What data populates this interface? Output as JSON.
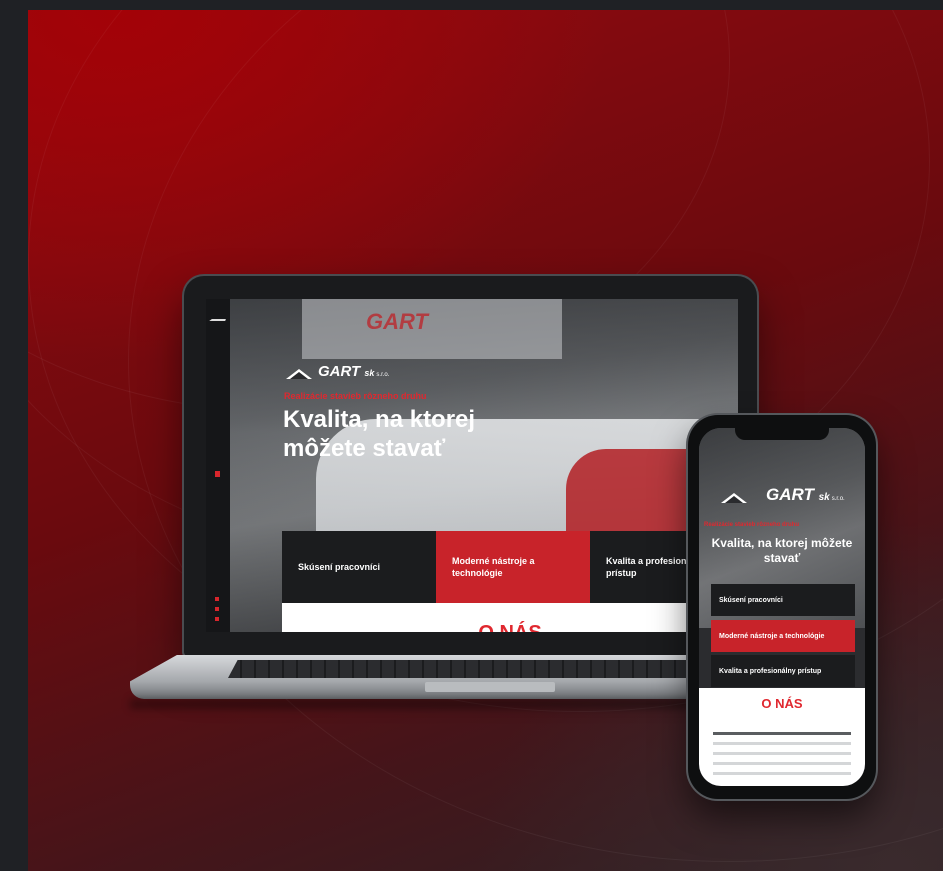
{
  "laptop_site": {
    "logo_text": "GART",
    "logo_suffix": "sk",
    "logo_sub": "s.r.o.",
    "tagline": "Realizácie stavieb rôzneho druhu",
    "title": "Kvalita, na ktorej môžete stavať",
    "features": [
      "Skúsení pracovníci",
      "Moderné nástroje a technológie",
      "Kvalita a profesionálny prístup"
    ],
    "about_title": "O NÁS"
  },
  "phone_site": {
    "logo_text": "GART",
    "logo_suffix": "sk",
    "logo_sub": "s.r.o.",
    "tagline": "Realizácie stavieb rôzneho druhu",
    "title": "Kvalita, na ktorej môžete stavať",
    "features": [
      "Skúsení pracovníci",
      "Moderné nástroje a technológie",
      "Kvalita a profesionálny prístup"
    ],
    "about_title": "O NÁS"
  },
  "colors": {
    "accent": "#c8232a",
    "accent_text": "#e0282f",
    "background": "#1f2125"
  }
}
